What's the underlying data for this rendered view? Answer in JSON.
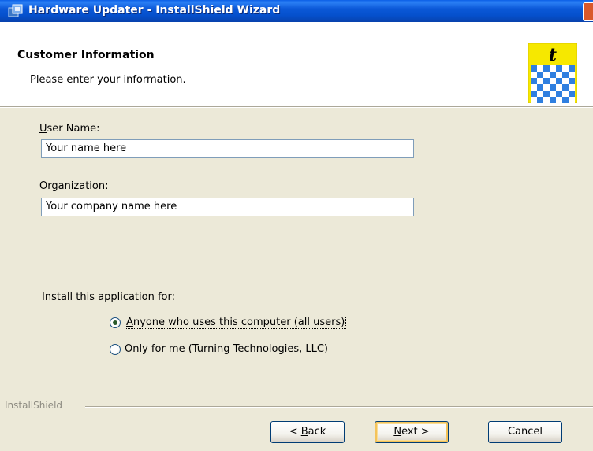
{
  "window": {
    "title": "Hardware Updater - InstallShield Wizard"
  },
  "header": {
    "title": "Customer Information",
    "subtitle": "Please enter your information.",
    "logo_letter": "t"
  },
  "form": {
    "user_name": {
      "label_accel": "U",
      "label_rest": "ser Name:",
      "value": "Your name here"
    },
    "organization": {
      "label_accel": "O",
      "label_rest": "rganization:",
      "value": "Your company name here"
    },
    "install_for": {
      "label": "Install this application for:",
      "options": [
        {
          "accel": "A",
          "rest": "nyone who uses this computer (all users)",
          "selected": true
        },
        {
          "prefix": "Only for ",
          "accel": "m",
          "rest": "e (Turning Technologies, LLC)",
          "selected": false
        }
      ]
    }
  },
  "footer": {
    "brand": "InstallShield"
  },
  "buttons": {
    "back": {
      "prefix": "< ",
      "accel": "B",
      "rest": "ack"
    },
    "next": {
      "accel": "N",
      "rest": "ext >"
    },
    "cancel": {
      "label": "Cancel"
    }
  },
  "colors": {
    "titlebar": "#0550cc",
    "dialog_bg": "#ece9d8",
    "logo_yellow": "#f6e800",
    "logo_blue": "#2f7fe0"
  },
  "icons": {
    "title_icon": "installer-icon",
    "logo": "turning-technologies-logo",
    "close": "close-icon"
  }
}
